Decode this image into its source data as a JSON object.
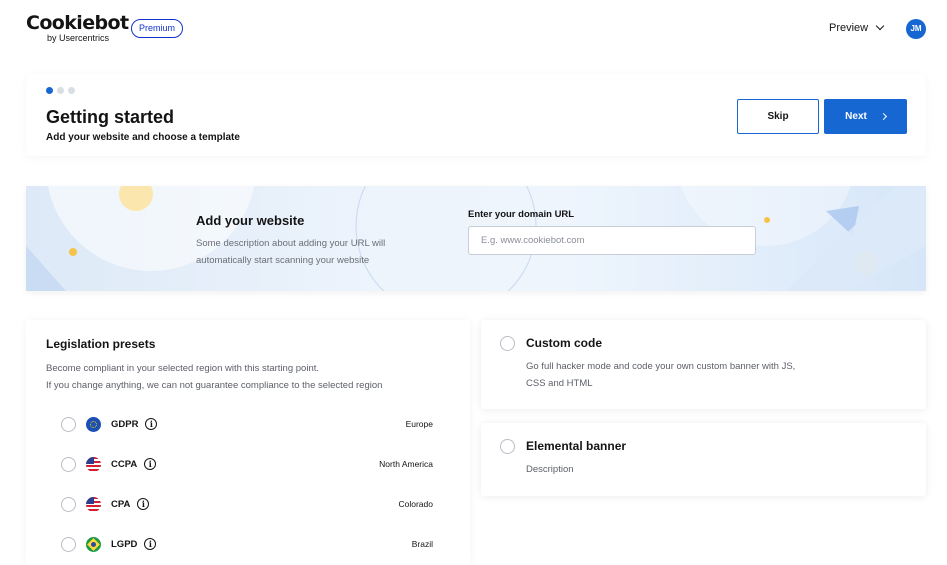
{
  "header": {
    "logo_text": "Cookiebot",
    "logo_sub": "by Usercentrics",
    "badge": "Premium",
    "preview_label": "Preview",
    "avatar_initials": "JM"
  },
  "onboarding": {
    "step_current": 1,
    "step_total": 3,
    "title": "Getting started",
    "subtitle": "Add your website and choose a template",
    "skip_label": "Skip",
    "next_label": "Next"
  },
  "website": {
    "title": "Add your website",
    "description": "Some description about adding your URL will automatically start scanning your website",
    "domain_label": "Enter your domain URL",
    "domain_placeholder": "E.g. www.cookiebot.com",
    "domain_value": ""
  },
  "presets": {
    "title": "Legislation presets",
    "description_line1": "Become compliant in your selected region with this starting point.",
    "description_line2": "If you change anything, we can not guarantee compliance to the selected region",
    "items": [
      {
        "code": "GDPR",
        "region": "Europe",
        "flag": "eu-flag-icon"
      },
      {
        "code": "CCPA",
        "region": "North America",
        "flag": "us-flag-icon"
      },
      {
        "code": "CPA",
        "region": "Colorado",
        "flag": "us-flag-icon"
      },
      {
        "code": "LGPD",
        "region": "Brazil",
        "flag": "brazil-flag-icon"
      }
    ]
  },
  "options": {
    "custom_code": {
      "title": "Custom code",
      "description": "Go full hacker mode and code your own custom banner with JS, CSS and HTML"
    },
    "elemental": {
      "title": "Elemental banner",
      "description": "Description"
    }
  },
  "colors": {
    "primary": "#1767d3",
    "badge_blue": "#1032cf",
    "text": "#141414",
    "muted": "#5c6068"
  }
}
